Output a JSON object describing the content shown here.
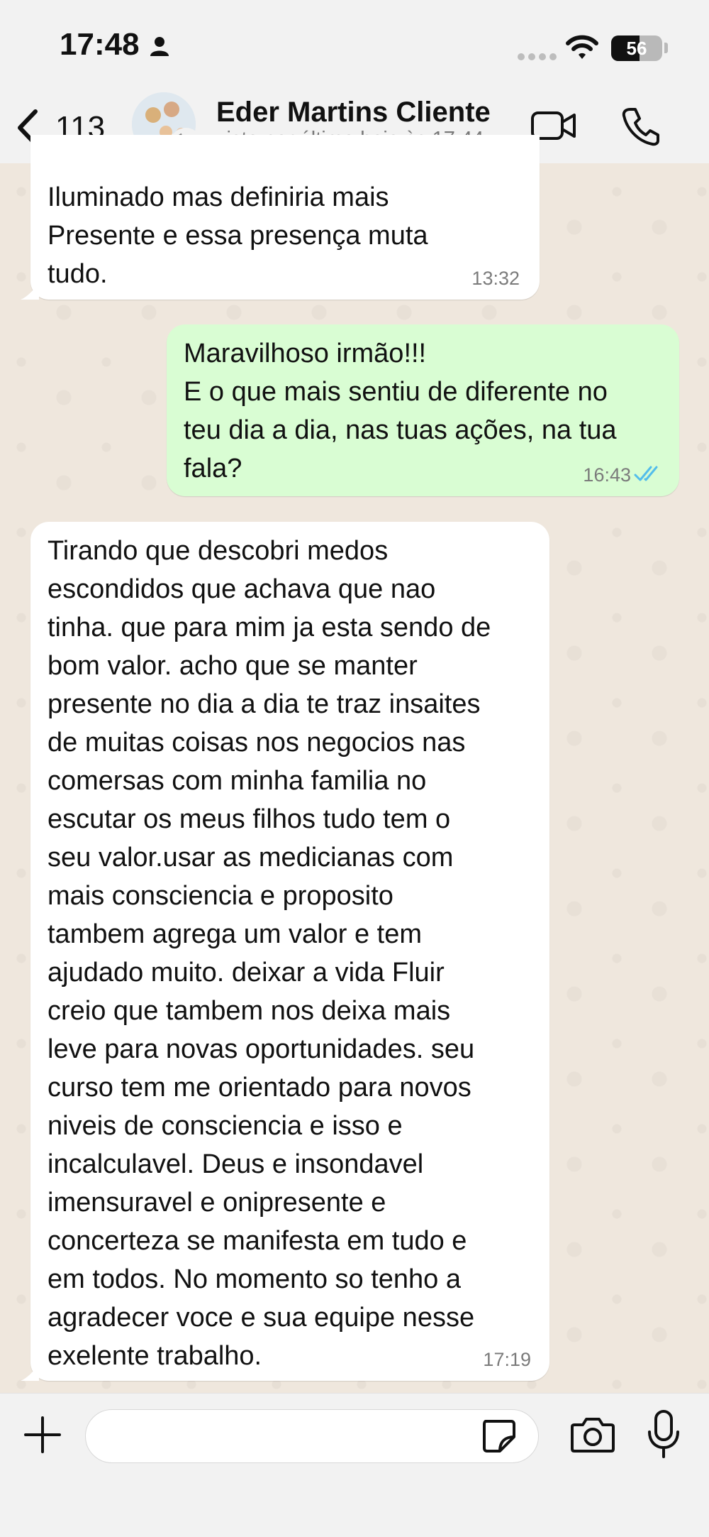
{
  "status_bar": {
    "time": "17:48",
    "battery_percent": "56",
    "battery_level": 0.56,
    "icons": [
      "person-icon",
      "signal-icon",
      "wifi-icon",
      "battery-icon"
    ]
  },
  "header": {
    "back_count": "113",
    "contact_name": "Eder Martins Cliente",
    "last_seen": "visto por último hoje às 17:44",
    "icons": [
      "chevron-left-icon",
      "video-call-icon",
      "phone-icon"
    ]
  },
  "messages": [
    {
      "direction": "incoming",
      "text": "Iluminado mas definiria mais\nPresente e essa presença muta\ntudo.",
      "time": "13:32"
    },
    {
      "direction": "outgoing",
      "text": "Maravilhoso irmão!!!\nE o que mais sentiu de diferente no\nteu dia a dia, nas tuas ações, na tua\nfala?",
      "time": "16:43",
      "status": "read"
    },
    {
      "direction": "incoming",
      "text": "Tirando que descobri medos\nescondidos que achava que nao\ntinha. que para mim ja esta sendo de\nbom valor. acho que se manter\npresente no dia a dia te traz insaites\nde muitas coisas nos negocios nas\ncomersas  com minha familia no\nescutar os meus filhos tudo  tem o\nseu valor.usar as medicianas com\nmais consciencia e proposito\ntambem agrega um valor e tem\najudado muito. deixar a vida Fluir\ncreio que tambem nos deixa mais\nleve para novas oportunidades. seu\ncurso tem me orientado para novos\nniveis de consciencia e isso e\nincalculavel. Deus e insondavel\nimensuravel e onipresente  e\nconcerteza se manifesta em tudo e\nem todos. No momento so tenho a\nagradecer voce e sua equipe nesse\nexelente trabalho.",
      "time": "17:19"
    }
  ],
  "composer": {
    "placeholder": "",
    "value": "",
    "icons": [
      "plus-icon",
      "sticker-icon",
      "camera-icon",
      "microphone-icon"
    ]
  },
  "colors": {
    "incoming_bubble": "#ffffff",
    "outgoing_bubble": "#d9fdd3",
    "read_ticks": "#53bdeb",
    "chat_background": "#efe7dd"
  }
}
